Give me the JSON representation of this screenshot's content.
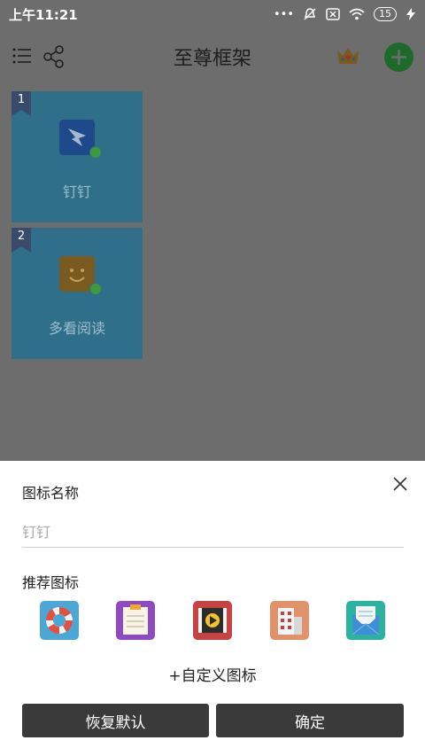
{
  "status_bar": {
    "time": "上午11:21",
    "signal_dots": "•••",
    "battery": "15"
  },
  "header": {
    "title": "至尊框架",
    "icons": [
      "list-icon",
      "share-icon",
      "crown-icon",
      "add-icon"
    ],
    "accent_color": "#2e9e3e"
  },
  "grid": {
    "tiles": [
      {
        "number": "1",
        "label": "钉钉",
        "icon": "dingtalk-icon"
      },
      {
        "number": "2",
        "label": "多看阅读",
        "icon": "duokan-icon"
      }
    ]
  },
  "sheet": {
    "name_label": "图标名称",
    "name_input_placeholder": "钉钉",
    "recommended_label": "推荐图标",
    "recommended_icons": [
      "lifebuoy-icon",
      "notepad-icon",
      "video-icon",
      "building-icon",
      "mail-icon"
    ],
    "custom_label": "+自定义图标",
    "restore_label": "恢复默认",
    "confirm_label": "确定"
  }
}
